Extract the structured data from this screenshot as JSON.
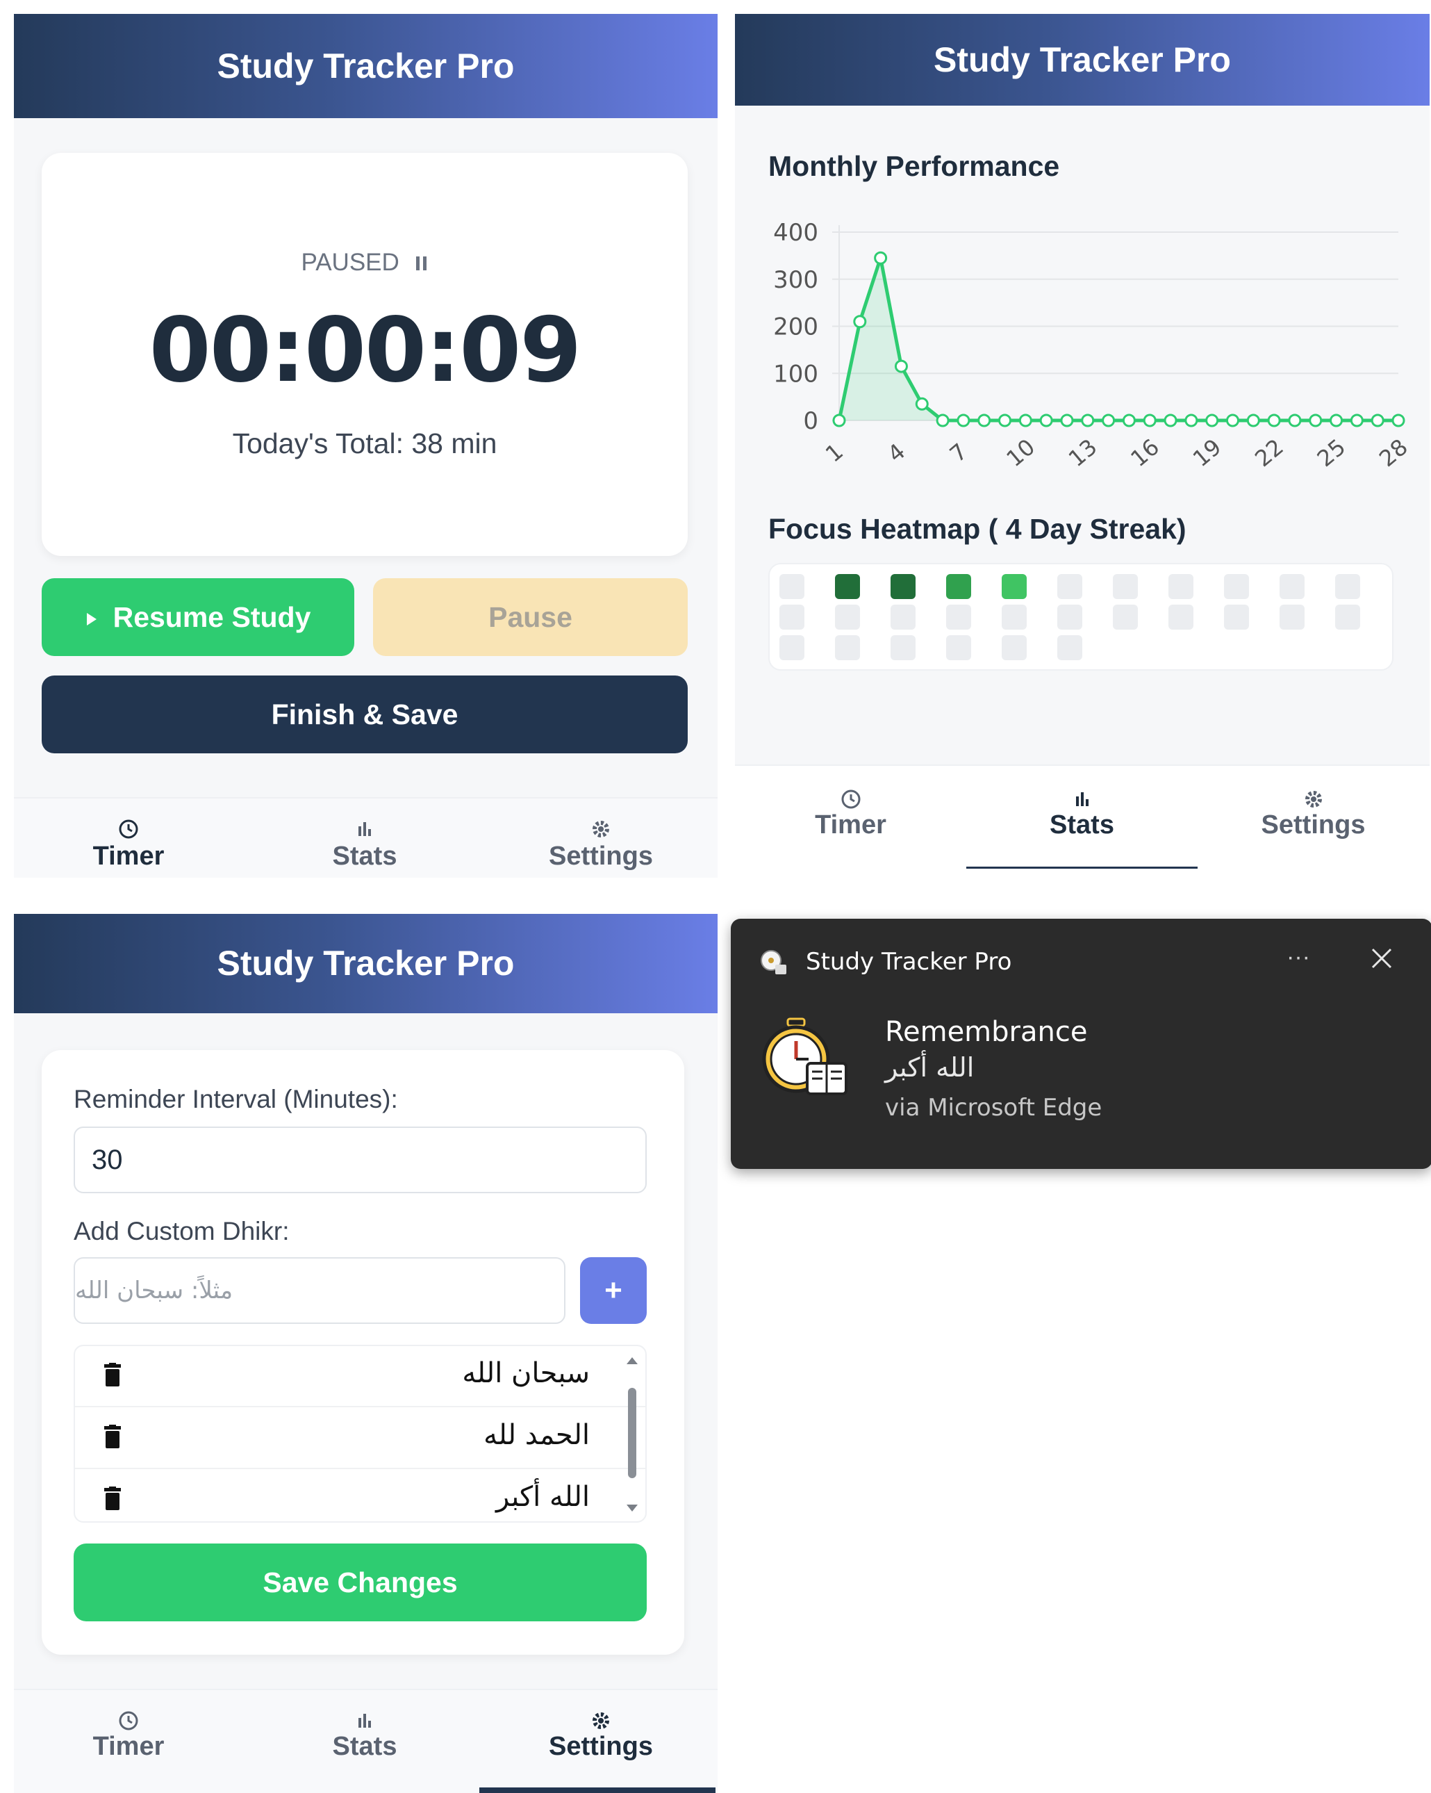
{
  "app_title": "Study Tracker Pro",
  "timer_panel": {
    "status": "PAUSED",
    "time": "00:00:09",
    "today_total": "Today's Total: 38 min",
    "resume_label": "Resume Study",
    "pause_label": "Pause",
    "finish_label": "Finish & Save"
  },
  "stats_panel": {
    "chart_data": {
      "type": "line",
      "title": "Monthly Performance",
      "x": [
        1,
        2,
        3,
        4,
        5,
        6,
        7,
        8,
        9,
        10,
        11,
        12,
        13,
        14,
        15,
        16,
        17,
        18,
        19,
        20,
        21,
        22,
        23,
        24,
        25,
        26,
        27,
        28
      ],
      "x_tick_labels": [
        "1",
        "4",
        "7",
        "10",
        "13",
        "16",
        "19",
        "22",
        "25",
        "28"
      ],
      "y_tick_labels": [
        "400",
        "300",
        "200",
        "100",
        "0"
      ],
      "values": [
        0,
        210,
        345,
        115,
        35,
        0,
        0,
        0,
        0,
        0,
        0,
        0,
        0,
        0,
        0,
        0,
        0,
        0,
        0,
        0,
        0,
        0,
        0,
        0,
        0,
        0,
        0,
        0
      ],
      "ylim": [
        0,
        400
      ],
      "color": "#2ecc71",
      "grid": true
    },
    "heatmap_title": "Focus Heatmap ( 4 Day Streak)",
    "heatmap_levels": [
      0,
      4,
      4,
      3,
      2,
      0,
      0,
      0,
      0,
      0,
      0,
      0,
      0,
      0,
      0,
      0,
      0,
      0,
      0,
      0,
      0,
      0,
      0,
      0,
      0,
      0,
      0,
      0
    ],
    "heatmap_colors": [
      "#ebedf0",
      "#9be9a8",
      "#40c463",
      "#30a14e",
      "#216e39"
    ]
  },
  "settings_panel": {
    "interval_label": "Reminder Interval (Minutes):",
    "interval_value": "30",
    "dhikr_label": "Add Custom Dhikr:",
    "dhikr_placeholder": "مثلاً: سبحان الله",
    "add_button": "+",
    "dhikr_items": [
      "سبحان الله",
      "الحمد لله",
      "الله أكبر"
    ],
    "save_label": "Save Changes"
  },
  "nav": {
    "timer": "Timer",
    "stats": "Stats",
    "settings": "Settings"
  },
  "notification": {
    "app_name": "Study Tracker Pro",
    "more": "···",
    "title": "Remembrance",
    "message": "الله أكبر",
    "source": "via Microsoft Edge"
  }
}
